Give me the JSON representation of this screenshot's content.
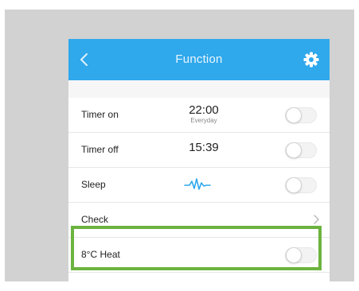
{
  "colors": {
    "appbar": "#2fa8ec",
    "highlight": "#6cb33f",
    "frame": "#d2d2d2",
    "wave": "#2fa8ec"
  },
  "appbar": {
    "title": "Function",
    "back_icon": "chevron-left-icon",
    "settings_icon": "gear-icon"
  },
  "rows": [
    {
      "label": "Timer on",
      "time": "22:00",
      "subtext": "Everyday",
      "toggle_on": false
    },
    {
      "label": "Timer off",
      "time": "15:39",
      "toggle_on": false
    },
    {
      "label": "Sleep",
      "icon": "sleep-wave-icon",
      "toggle_on": false
    },
    {
      "label": "Check",
      "icon": "chevron-right-icon"
    },
    {
      "label": "8°C Heat",
      "toggle_on": false,
      "highlighted": true
    }
  ]
}
